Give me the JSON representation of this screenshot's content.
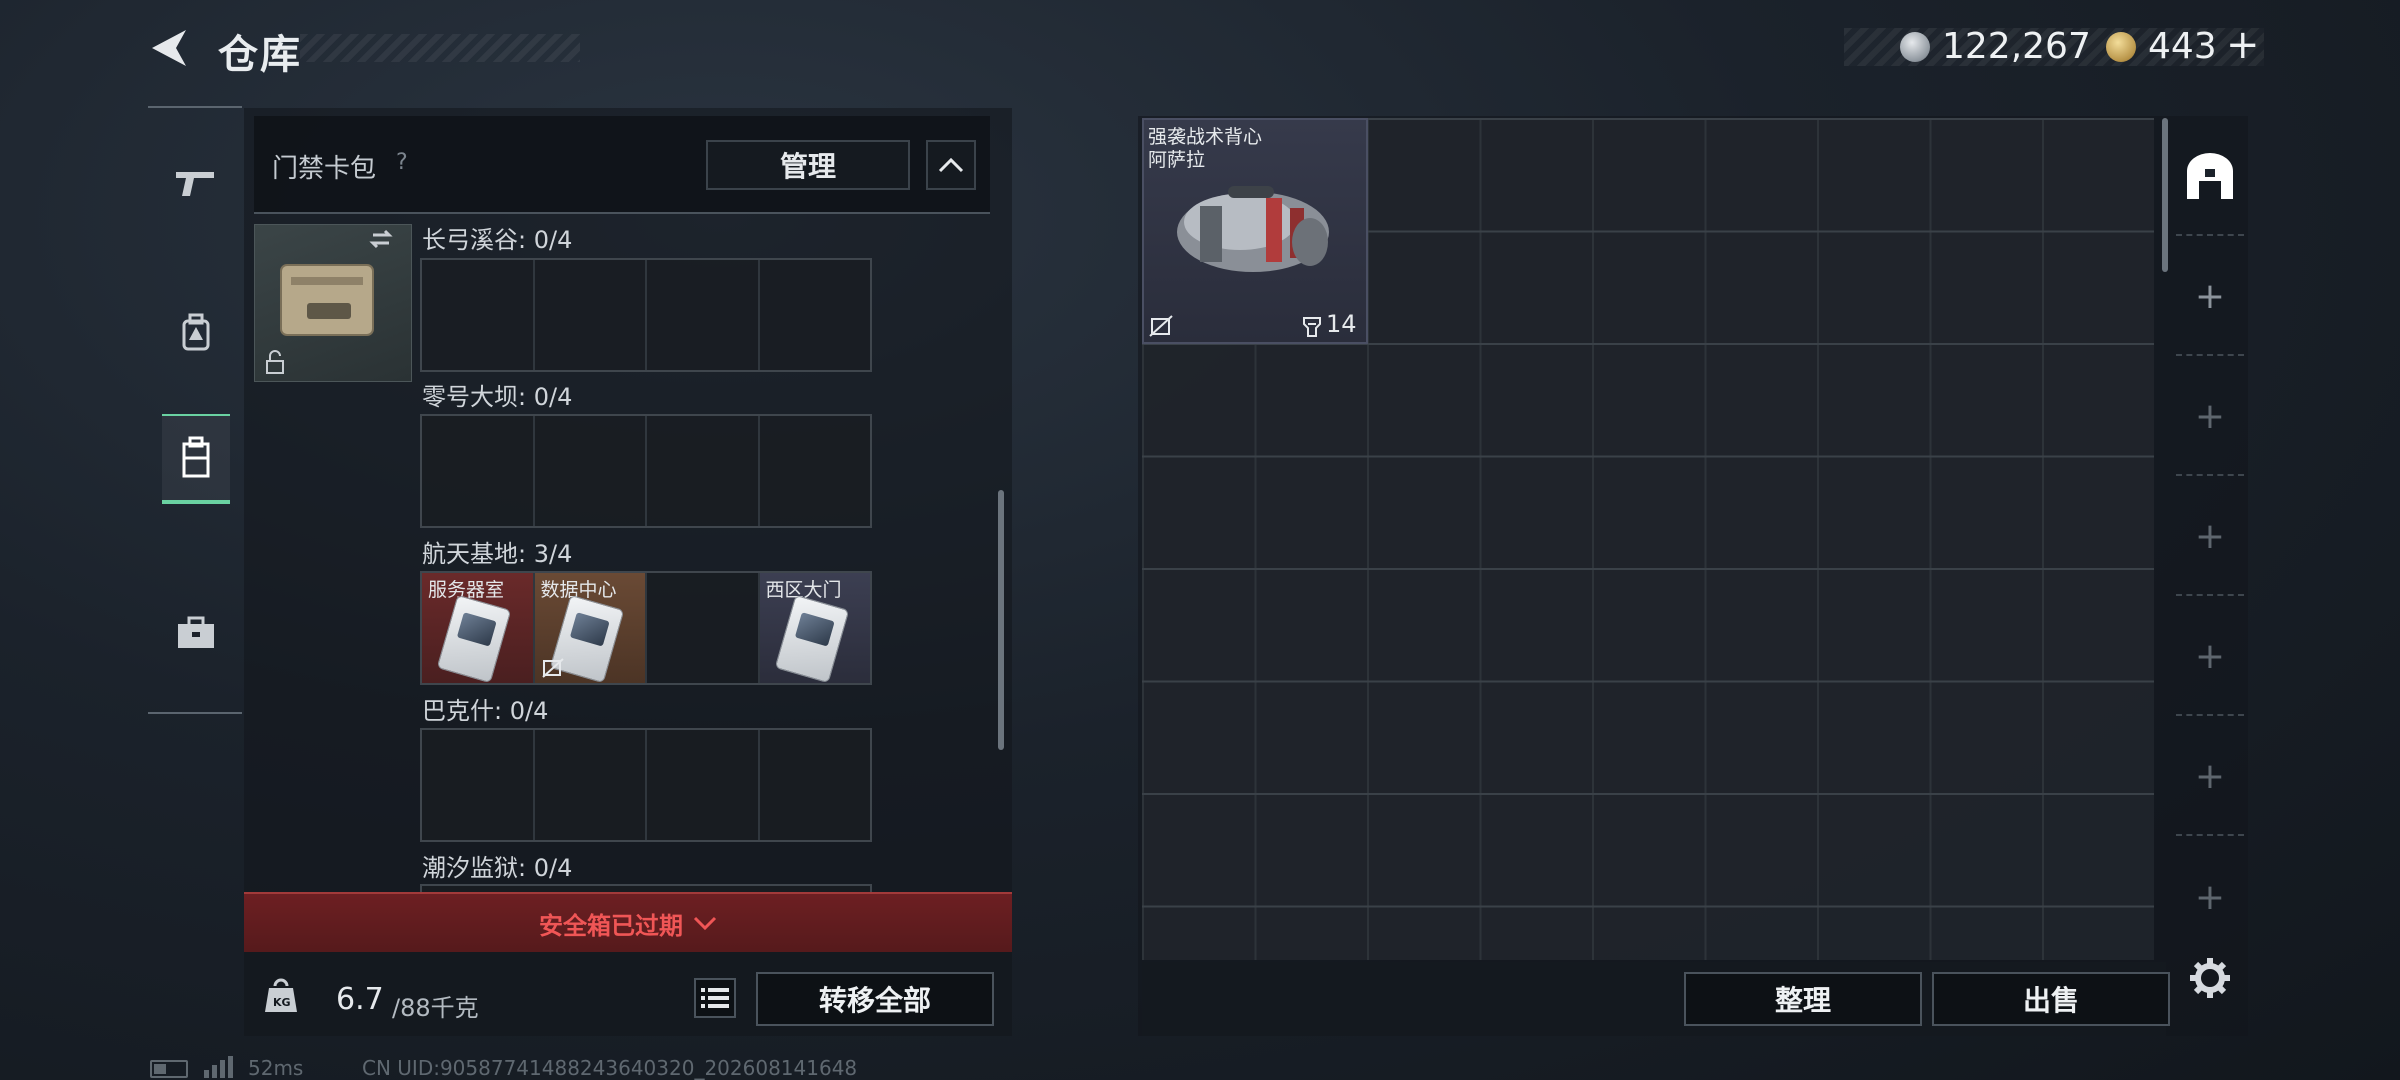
{
  "header": {
    "title": "仓库",
    "currency": [
      {
        "name": "silver-coin",
        "value": "122,267"
      },
      {
        "name": "gold-coin",
        "value": "443"
      }
    ],
    "currency_plus": "+"
  },
  "left_nav": [
    "gun-icon",
    "backpack-icon",
    "chest-rig-icon",
    "briefcase-icon"
  ],
  "cardpack": {
    "title": "门禁卡包",
    "help": "?",
    "manage_label": "管理",
    "sections": [
      {
        "label": "长弓溪谷: 0/4",
        "slots": [
          "",
          "",
          "",
          ""
        ]
      },
      {
        "label": "零号大坝: 0/4",
        "slots": [
          "",
          "",
          "",
          ""
        ]
      },
      {
        "label": "航天基地: 3/4",
        "slots": [
          "服务器室",
          "数据中心",
          "",
          "西区大门"
        ]
      },
      {
        "label": "巴克什: 0/4",
        "slots": [
          "",
          "",
          "",
          ""
        ]
      },
      {
        "label": "潮汐监狱: 0/4",
        "slots": [
          "",
          "",
          "",
          ""
        ]
      }
    ],
    "expired_text": "安全箱已过期",
    "weight_value": "6.7",
    "weight_max": "/88千克",
    "transfer_all_label": "转移全部"
  },
  "stash": {
    "item": {
      "name_line1": "强袭战术背心",
      "name_line2": "阿萨拉",
      "count": "14"
    },
    "sort_label": "整理",
    "sell_label": "出售",
    "rail_plus": "+"
  },
  "status": {
    "ping": "52ms",
    "uid": "CN UID:9058774148824364032​0_202608141648"
  }
}
